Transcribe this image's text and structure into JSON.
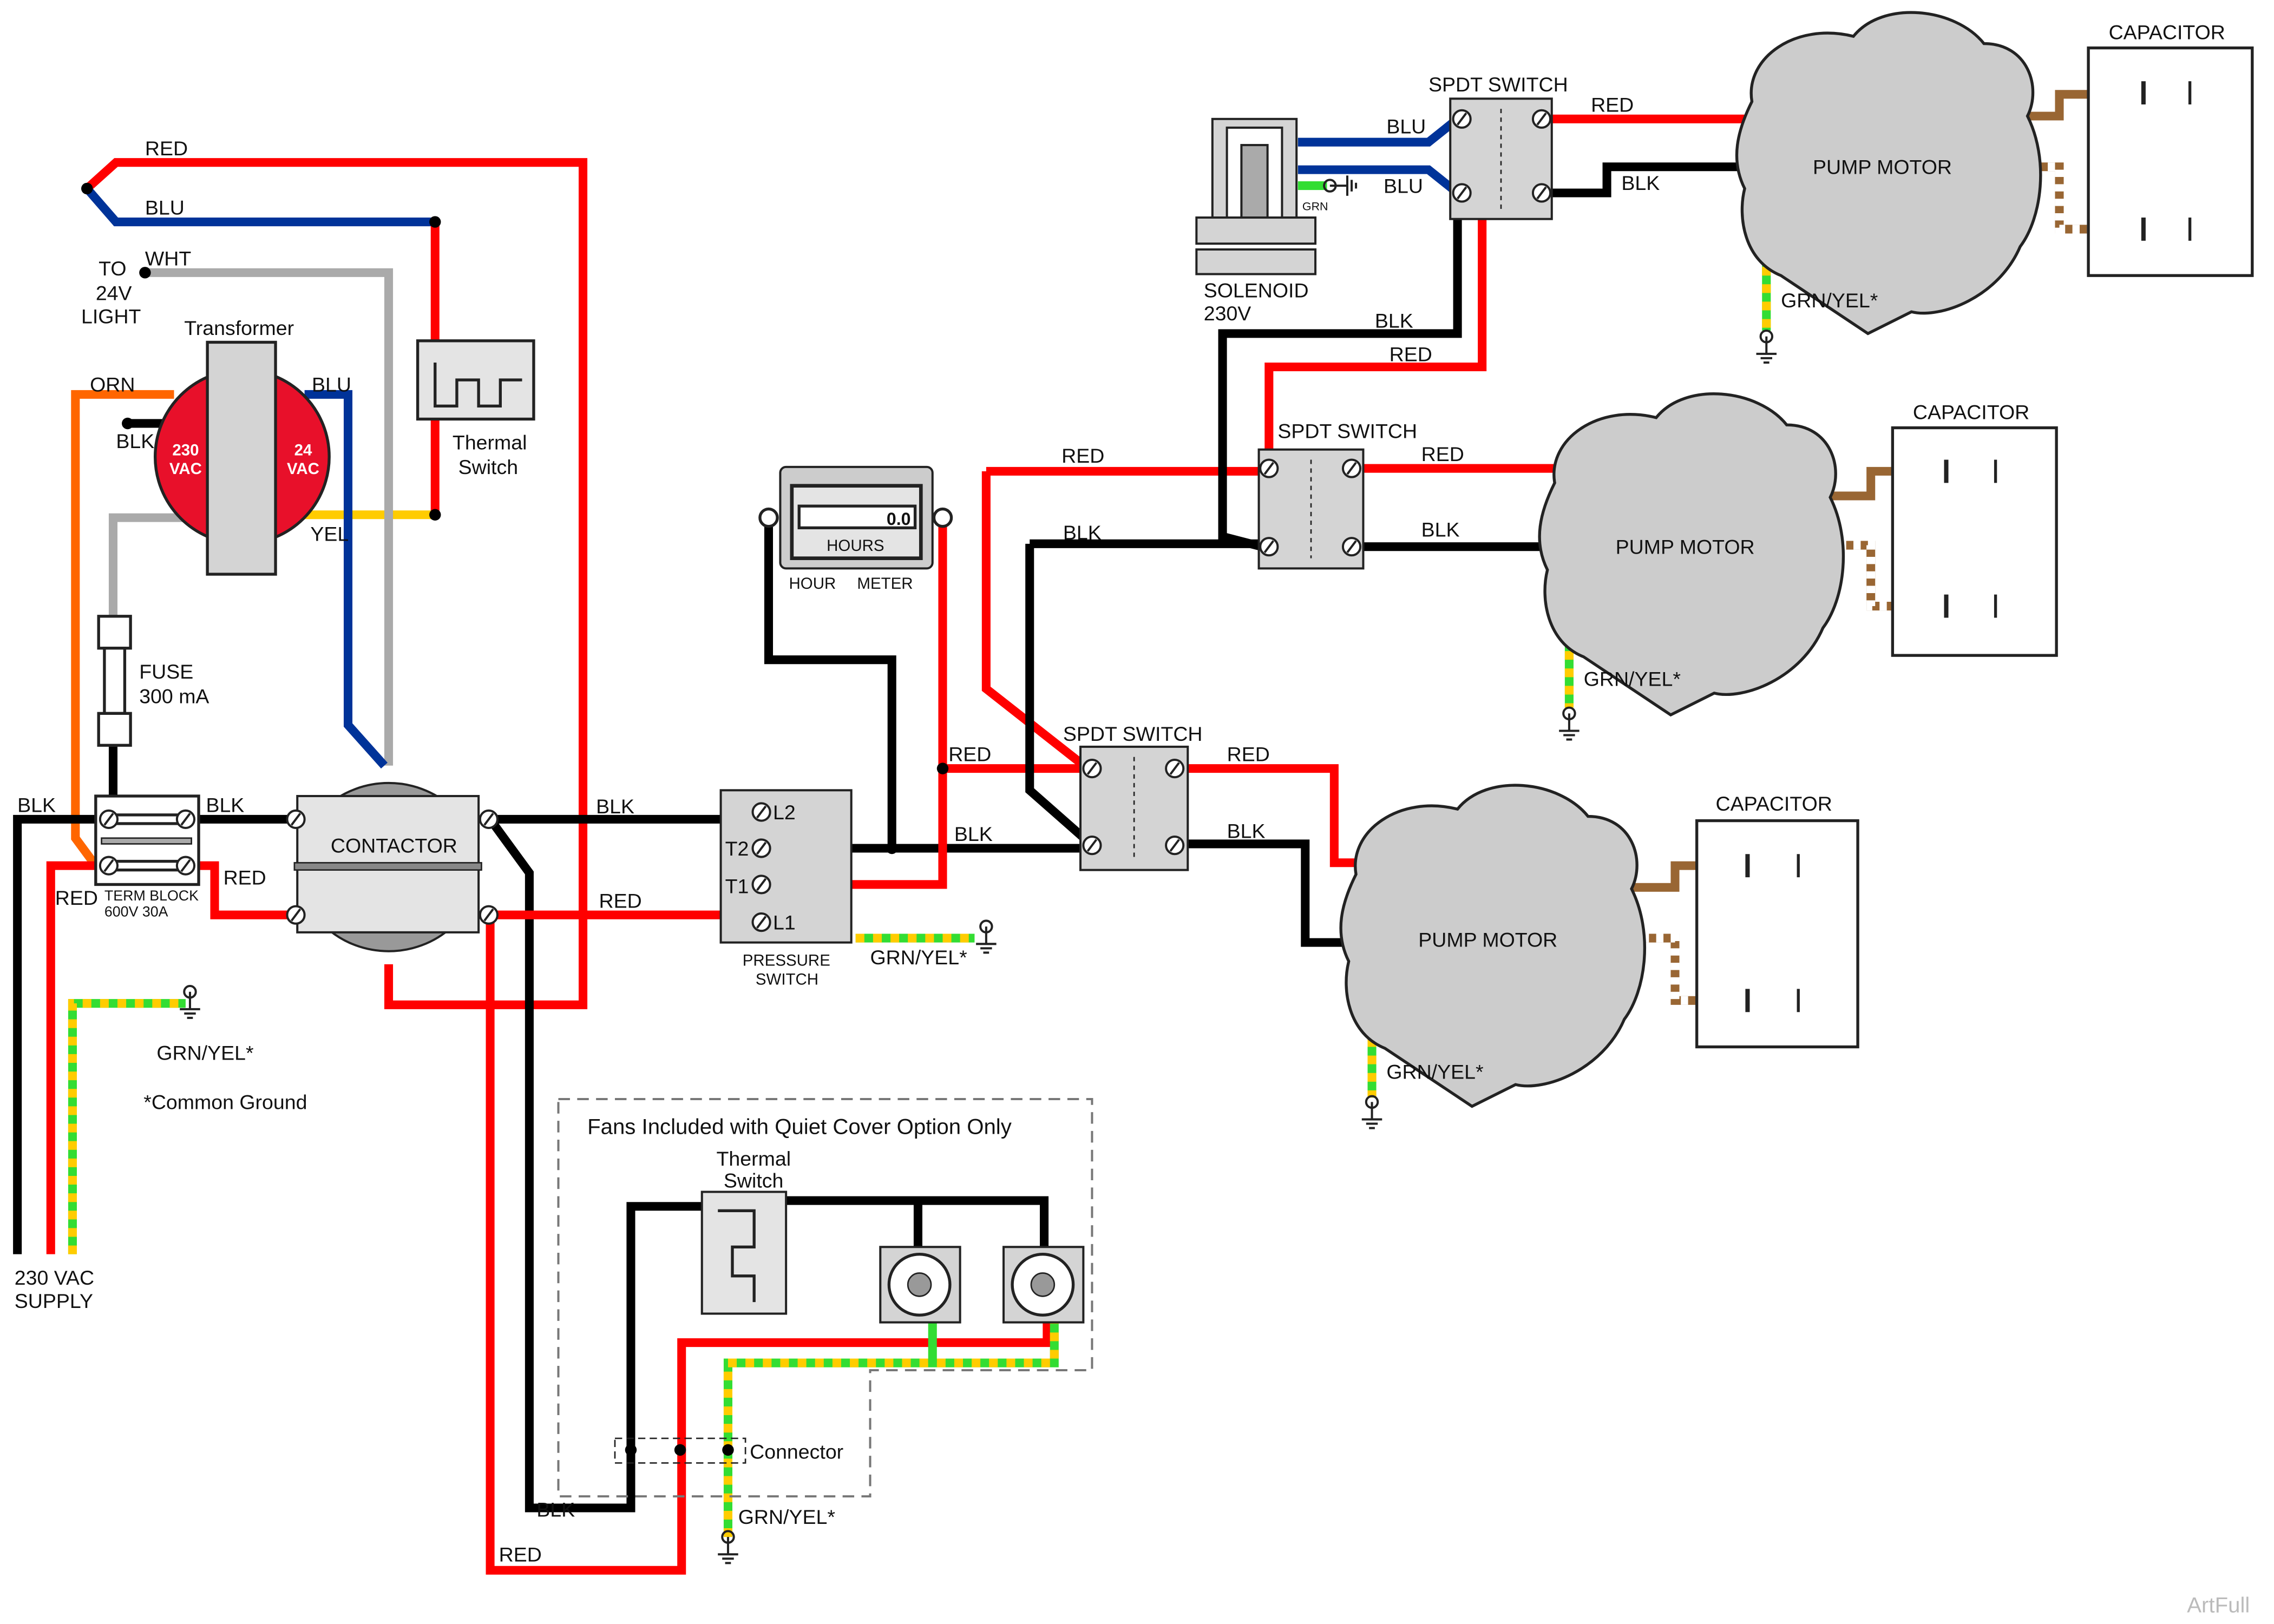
{
  "colors": {
    "red": "#ff0000",
    "black": "#000000",
    "blue": "#003399",
    "white": "#aaaaaa",
    "orange": "#ff6600",
    "yellow": "#ffcc00",
    "green": "#33dd33",
    "brown": "#996633",
    "component": "#d4d4d4"
  },
  "wire_labels": {
    "red": "RED",
    "blu": "BLU",
    "wht": "WHT",
    "orn": "ORN",
    "blk": "BLK",
    "yel": "YEL",
    "grn": "GRN",
    "grnyel": "GRN/YEL*"
  },
  "light": {
    "line1": "TO",
    "line2": "24V",
    "line3": "LIGHT"
  },
  "transformer": {
    "title": "Transformer",
    "primary_top": "230",
    "primary_bottom": "VAC",
    "secondary_top": "24",
    "secondary_bottom": "VAC"
  },
  "thermal_switch_top": {
    "line1": "Thermal",
    "line2": "Switch"
  },
  "fuse": {
    "line1": "FUSE",
    "line2": "300 mA"
  },
  "term_block": {
    "line1": "TERM BLOCK",
    "line2": "600V 30A"
  },
  "contactor": {
    "label": "CONTACTOR"
  },
  "pressure_switch": {
    "line1": "PRESSURE",
    "line2": "SWITCH",
    "terminals": [
      "L2",
      "T2",
      "T1",
      "L1"
    ]
  },
  "hour_meter": {
    "reading": "0.0",
    "unit": "HOURS",
    "label_left": "HOUR",
    "label_right": "METER"
  },
  "solenoid": {
    "line1": "SOLENOID",
    "line2": "230V"
  },
  "spdt_switch": "SPDT SWITCH",
  "pump_motor": "PUMP MOTOR",
  "capacitor": "CAPACITOR",
  "common_ground_note": "*Common Ground",
  "supply": {
    "line1": "230 VAC",
    "line2": "SUPPLY"
  },
  "fans_box": {
    "title": "Fans Included with Quiet Cover Option Only",
    "thermal_line1": "Thermal",
    "thermal_line2": "Switch",
    "connector": "Connector"
  },
  "watermark": "ArtFull"
}
